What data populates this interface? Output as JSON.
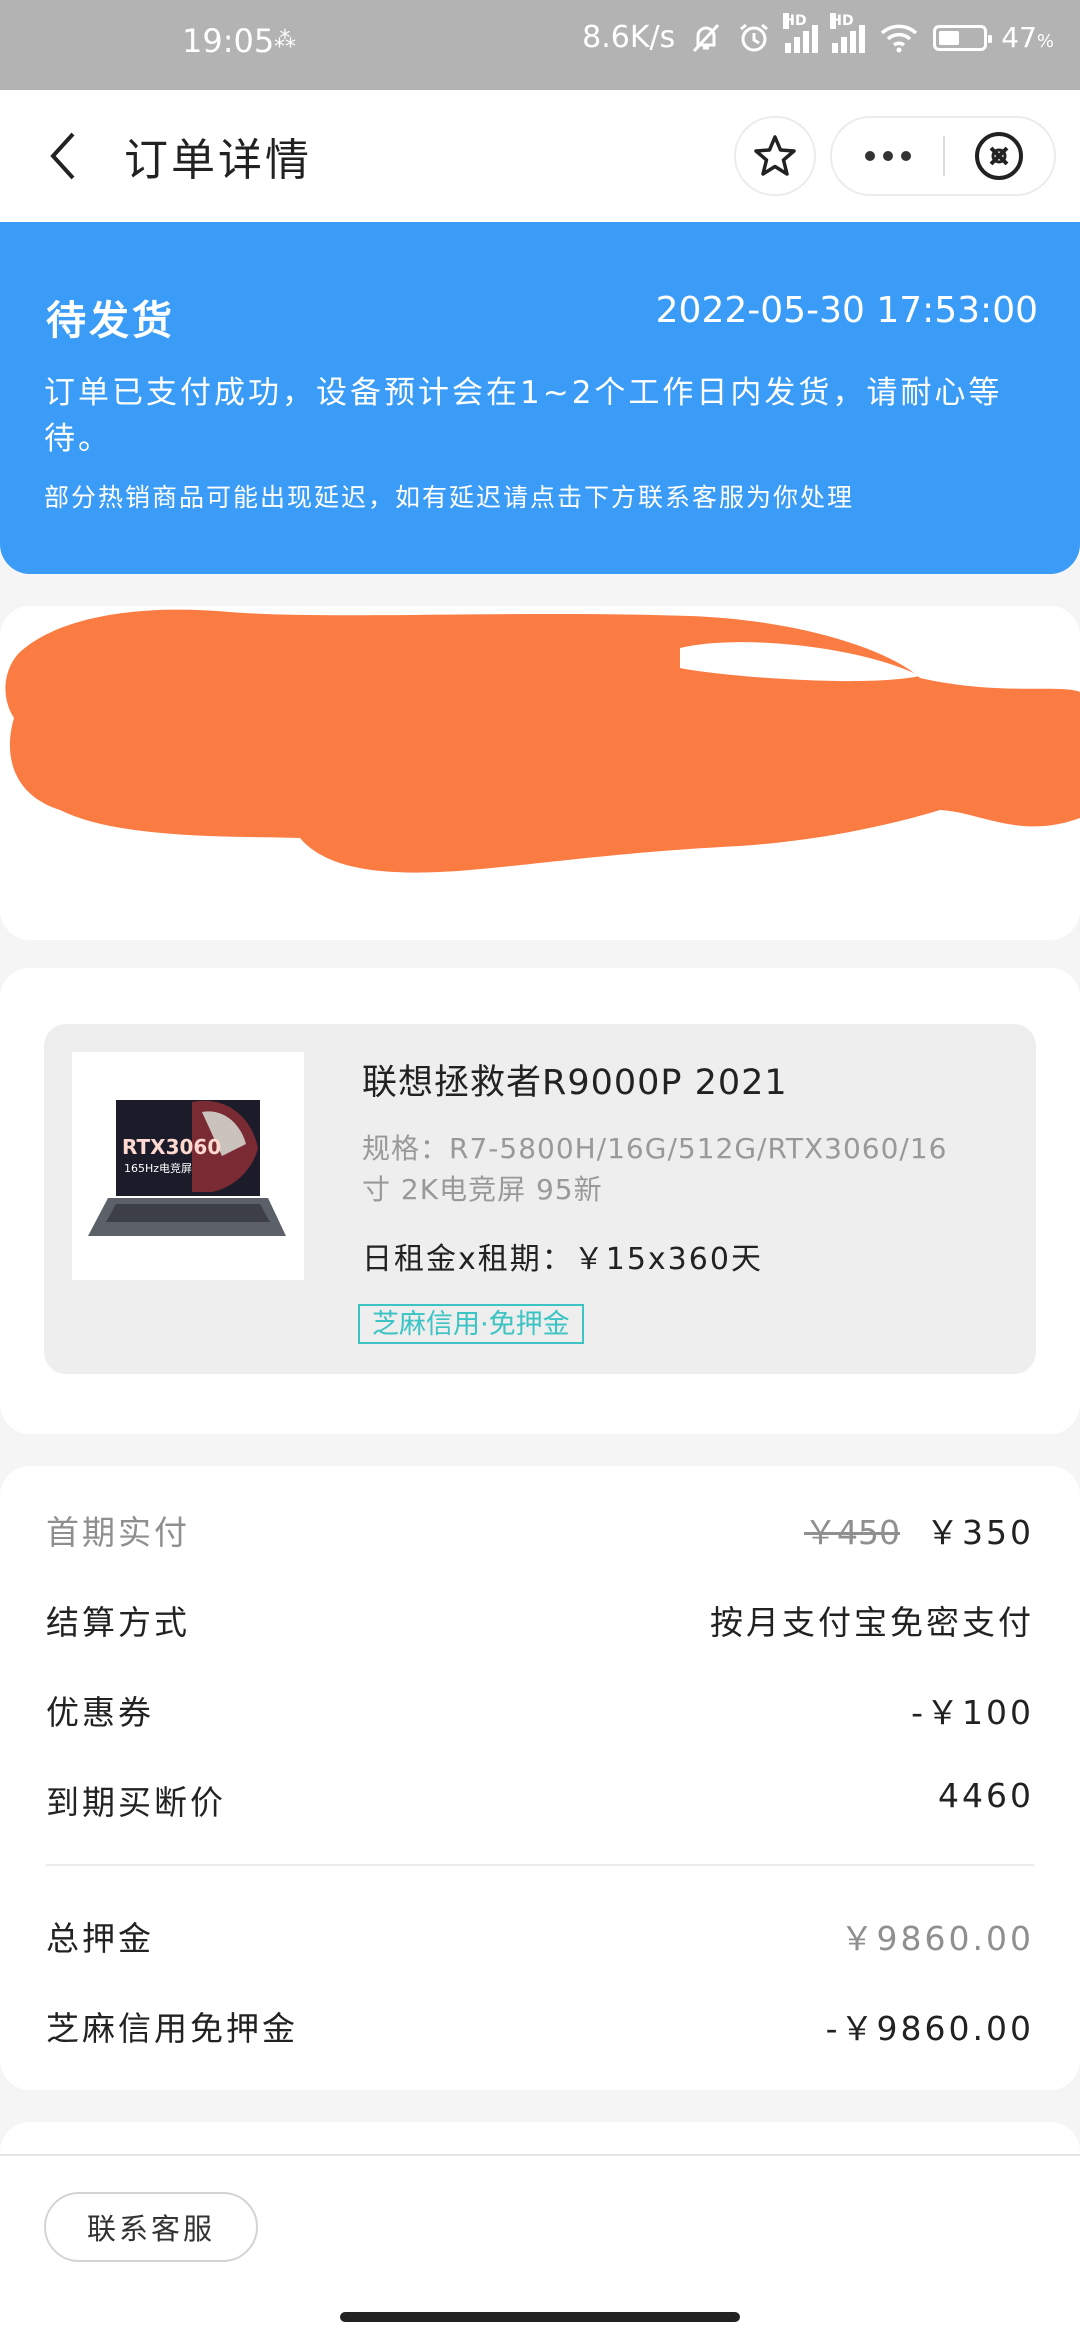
{
  "status_bar": {
    "time": "19:05",
    "network_speed": "8.6K/s",
    "signal_label": "HD",
    "battery": "47",
    "battery_level": 0.47,
    "icons": [
      "mute-bell-icon",
      "alarm-icon",
      "signal-hd-icon",
      "signal-hd-icon",
      "wifi-icon",
      "battery-icon"
    ]
  },
  "nav": {
    "title": "订单详情",
    "icons": [
      "back-icon",
      "star-icon",
      "more-icon",
      "close-icon"
    ]
  },
  "order_status": {
    "title": "待发货",
    "time": "2022-05-30 17:53:00",
    "description": "订单已支付成功，设备预计会在1~2个工作日内发货，请耐心等待。",
    "note": "部分热销商品可能出现延迟，如有延迟请点击下方联系客服为你处理",
    "color": "#3a9cf6"
  },
  "address": {
    "redaction_color": "#fb7c43"
  },
  "product": {
    "name": "联想拯救者R9000P 2021",
    "spec": "规格：R7-5800H/16G/512G/RTX3060/16寸 2K电竞屏 95新",
    "rent": "日租金x租期：￥15x360天",
    "tag": "芝麻信用·免押金",
    "image_text": "RTX3060",
    "image_subtext": "165Hz电竞屏"
  },
  "payment": {
    "first_payment_label": "首期实付",
    "first_payment_original": "￥450",
    "first_payment_actual": "￥350",
    "settlement_label": "结算方式",
    "settlement_value": "按月支付宝免密支付",
    "coupon_label": "优惠券",
    "coupon_value": "-￥100",
    "buyout_label": "到期买断价",
    "buyout_value": "4460",
    "deposit_label": "总押金",
    "deposit_value": "￥9860.00",
    "deposit_free_label": "芝麻信用免押金",
    "deposit_free_value": "-￥9860.00"
  },
  "footer": {
    "contact_button": "联系客服"
  }
}
